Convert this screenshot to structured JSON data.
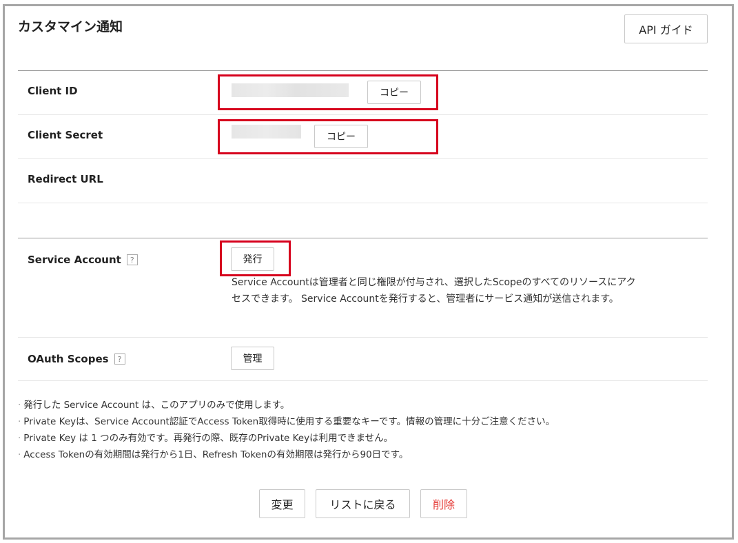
{
  "page": {
    "title": "カスタマイン通知"
  },
  "header": {
    "api_guide_label": "API ガイド"
  },
  "fields": {
    "client_id": {
      "label": "Client ID",
      "copy_label": "コピー"
    },
    "client_secret": {
      "label": "Client Secret",
      "copy_label": "コピー"
    },
    "redirect_url": {
      "label": "Redirect URL",
      "value": ""
    }
  },
  "service_account": {
    "label": "Service Account",
    "help": "?",
    "issue_label": "発行",
    "description": "Service Accountは管理者と同じ権限が付与され、選択したScopeのすべてのリソースにアクセスできます。 Service Accountを発行すると、管理者にサービス通知が送信されます。"
  },
  "oauth_scopes": {
    "label": "OAuth Scopes",
    "help": "?",
    "manage_label": "管理"
  },
  "notes": [
    "発行した Service Account は、このアプリのみで使用します。",
    "Private Keyは、Service Account認証でAccess Token取得時に使用する重要なキーです。情報の管理に十分ご注意ください。",
    "Private Key は 1 つのみ有効です。再発行の際、既存のPrivate Keyは利用できません。",
    "Access Tokenの有効期間は発行から1日、Refresh Tokenの有効期限は発行から90日です。"
  ],
  "footer": {
    "change_label": "変更",
    "back_label": "リストに戻る",
    "delete_label": "削除"
  },
  "colors": {
    "highlight": "#d6001c",
    "delete_text": "#e53935",
    "mask": "#e4e4e4"
  }
}
